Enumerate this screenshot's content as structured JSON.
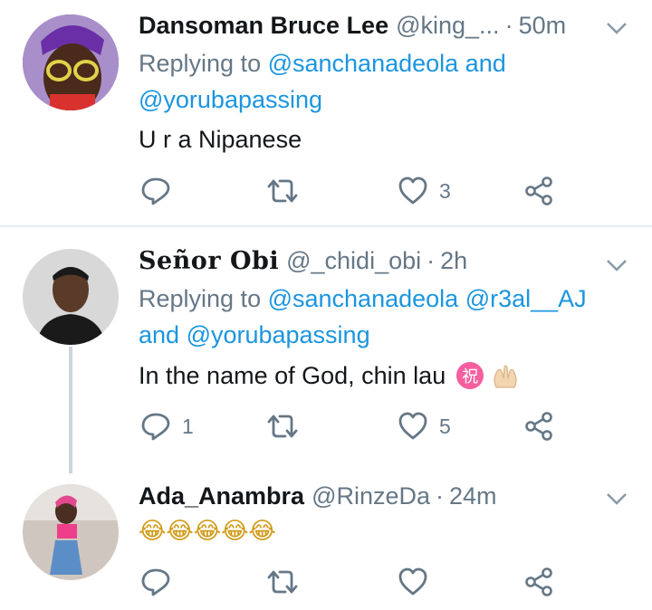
{
  "tweets": [
    {
      "name": "Dansoman Bruce Lee",
      "handle": "@king_...",
      "dot": "·",
      "time": "50m",
      "replying_prefix": "Replying to ",
      "mentions_line1": "@sanchanadeola",
      "and_word": " and",
      "mentions_line2": "@yorubapassing",
      "text": "U r a Nipanese",
      "reply_count": "",
      "retweet_count": "",
      "like_count": "3"
    },
    {
      "name": "Señor Obi",
      "handle": "@_chidi_obi",
      "dot": "·",
      "time": "2h",
      "replying_prefix": "Replying to ",
      "mentions_line1a": "@sanchanadeola",
      "mentions_line1b": "@r3al__AJ",
      "and_word": "and ",
      "mentions_line2": "@yorubapassing",
      "text": "In the name of God, chin lau",
      "emoji_badge": "祝",
      "reply_count": "1",
      "retweet_count": "",
      "like_count": "5"
    },
    {
      "name": "Ada_Anambra",
      "handle": "@RinzeDa",
      "dot": "·",
      "time": "24m",
      "text": "😂😂😂😂😂",
      "reply_count": "",
      "retweet_count": "",
      "like_count": ""
    }
  ],
  "icons": [
    "reply-icon",
    "retweet-icon",
    "like-icon",
    "share-icon",
    "chevron-down-icon"
  ],
  "colors": {
    "link": "#1b95e0",
    "muted": "#657786",
    "divider": "#e6ecf0",
    "thread": "#ccd6dd"
  }
}
